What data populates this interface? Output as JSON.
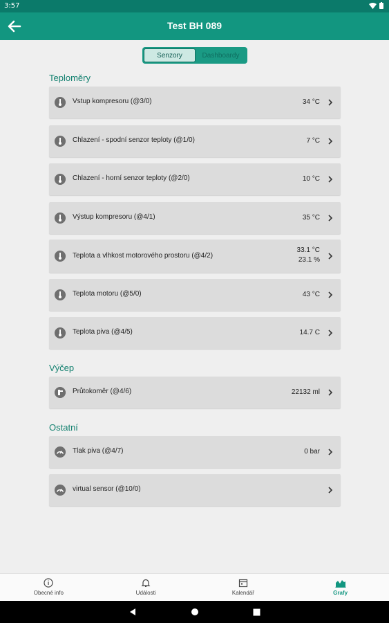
{
  "status_bar": {
    "time": "3:57"
  },
  "header": {
    "title": "Test BH 089"
  },
  "segmented": {
    "items": [
      "Senzory",
      "Dashboardy"
    ],
    "selected": "Senzory"
  },
  "sections": [
    {
      "title": "Teploměry",
      "items": [
        {
          "name": "Vstup kompresoru (@3/0)",
          "value": "34 °C"
        },
        {
          "name": "Chlazení - spodní senzor teploty (@1/0)",
          "value": "7 °C"
        },
        {
          "name": "Chlazení - horní senzor teploty (@2/0)",
          "value": "10 °C"
        },
        {
          "name": "Výstup kompresoru (@4/1)",
          "value": "35 °C"
        },
        {
          "name": "Teplota a vlhkost motorového prostoru (@4/2)",
          "value": "33.1 °C",
          "value2": "23.1 %"
        },
        {
          "name": "Teplota motoru (@5/0)",
          "value": "43 °C"
        },
        {
          "name": "Teplota piva (@4/5)",
          "value": "14.7 C"
        }
      ]
    },
    {
      "title": "Výčep",
      "items": [
        {
          "name": "Průtokoměr (@4/6)",
          "value": "22132 ml"
        }
      ]
    },
    {
      "title": "Ostatní",
      "items": [
        {
          "name": "Tlak piva (@4/7)",
          "value": "0 bar"
        },
        {
          "name": "virtual sensor (@10/0)",
          "value": ""
        }
      ]
    }
  ],
  "bottom_nav": [
    {
      "label": "Obecné info",
      "icon": "info-icon"
    },
    {
      "label": "Události",
      "icon": "bell-icon"
    },
    {
      "label": "Kalendář",
      "icon": "calendar-icon"
    },
    {
      "label": "Grafy",
      "icon": "chart-icon"
    }
  ],
  "colors": {
    "accent": "#129680",
    "status_bar": "#0b7a6a",
    "card": "#dcdcdc",
    "background": "#efefef"
  }
}
